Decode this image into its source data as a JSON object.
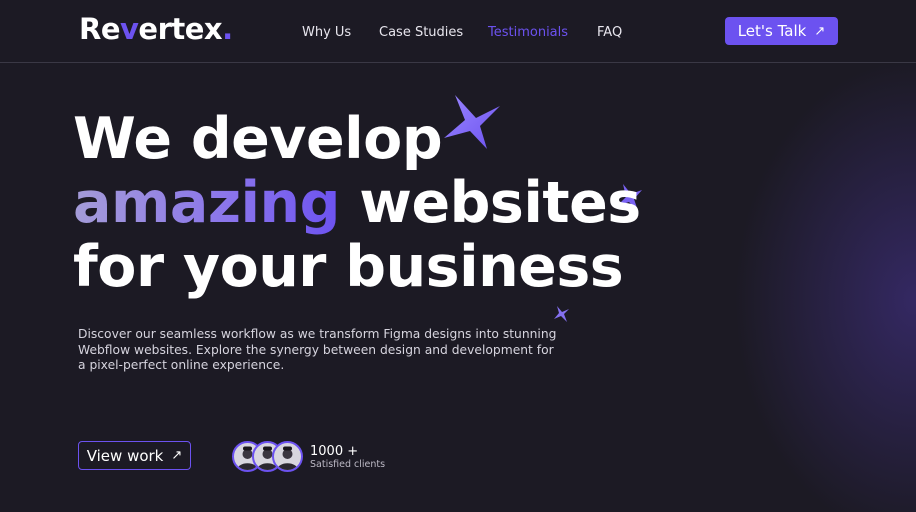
{
  "brand": {
    "logo_part1": "Re",
    "logo_part2": "v",
    "logo_part3": "ertex",
    "logo_dot": ".",
    "accent_color": "#6c52f0"
  },
  "nav": {
    "items": [
      {
        "label": "Why Us",
        "active": false
      },
      {
        "label": "Case Studies",
        "active": false
      },
      {
        "label": "Testimonials",
        "active": true
      },
      {
        "label": "FAQ",
        "active": false
      }
    ],
    "cta_label": "Let's Talk",
    "cta_icon": "arrow-up-right-icon"
  },
  "hero": {
    "line1": "We develop",
    "line2_highlight": "amazing",
    "line2_rest": "websites",
    "line3": "for your business",
    "description": "Discover our seamless workflow as we transform Figma designs into stunning Webflow websites. Explore the synergy between design and development for a pixel-perfect online experience."
  },
  "actions": {
    "view_work_label": "View work",
    "view_work_icon": "arrow-up-right-icon"
  },
  "social_proof": {
    "count": "1000 +",
    "label": "Satisfied clients",
    "avatars": [
      "avatar-1",
      "avatar-2",
      "avatar-3"
    ]
  },
  "decor": {
    "star_color": "#7a62f2",
    "stars": [
      "star-icon-large",
      "star-icon-medium",
      "star-icon-small"
    ]
  }
}
